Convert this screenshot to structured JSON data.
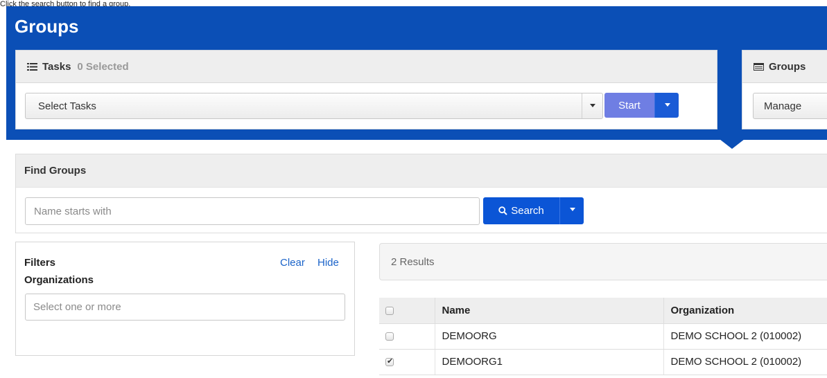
{
  "caption": "Click the search button to find a group.",
  "header": {
    "title": "Groups"
  },
  "tasks_panel": {
    "icon": "tasks-list-icon",
    "title": "Tasks",
    "selected_count": "0 Selected",
    "select_value": "Select Tasks",
    "start_label": "Start"
  },
  "groups_panel": {
    "icon": "groups-window-icon",
    "title": "Groups",
    "manage_value": "Manage"
  },
  "find_groups": {
    "title": "Find Groups",
    "search_placeholder": "Name starts with",
    "search_value": "",
    "search_label": "Search",
    "search_icon": "search-icon"
  },
  "filters": {
    "title": "Filters",
    "clear_label": "Clear",
    "hide_label": "Hide",
    "organizations_label": "Organizations",
    "organizations_placeholder": "Select one or more"
  },
  "results": {
    "summary": "2 Results",
    "columns": [
      "Name",
      "Organization"
    ],
    "rows": [
      {
        "checked": false,
        "name": "DEMOORG",
        "organization": "DEMO SCHOOL 2 (010002)"
      },
      {
        "checked": true,
        "name": "DEMOORG1",
        "organization": "DEMO SCHOOL 2 (010002)"
      }
    ]
  },
  "colors": {
    "brand_blue": "#0b4fb6",
    "start_button": "#6f7ee3",
    "search_button": "#0b55d6",
    "link": "#1a63c9"
  }
}
